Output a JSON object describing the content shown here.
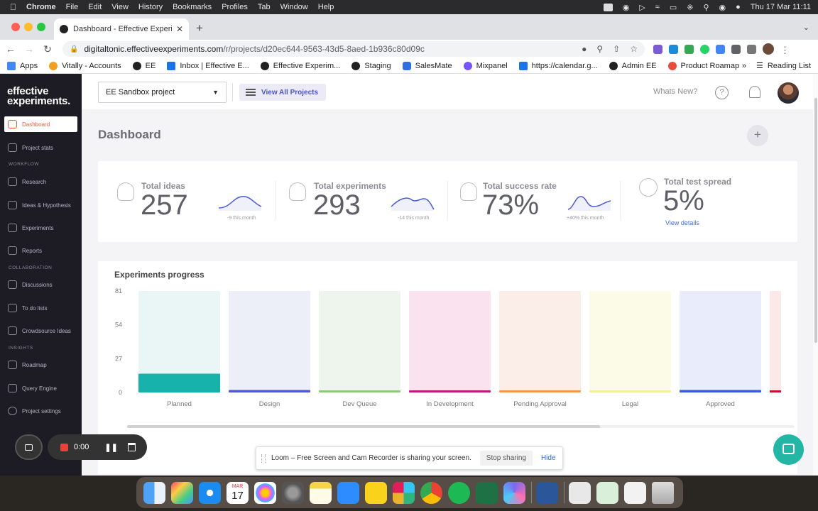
{
  "menubar": {
    "app": "Chrome",
    "items": [
      "File",
      "Edit",
      "View",
      "History",
      "Bookmarks",
      "Profiles",
      "Tab",
      "Window",
      "Help"
    ],
    "datetime": "Thu 17 Mar  11:11"
  },
  "browser": {
    "tab_title": "Dashboard - Effective Experim",
    "url_host": "digitaltonic.effectiveexperiments.com",
    "url_path": "/r/projects/d20ec644-9563-43d5-8aed-1b936c80d09c",
    "bookmarks": [
      "Apps",
      "Vitally - Accounts",
      "EE",
      "Inbox | Effective E...",
      "Effective Experim...",
      "Staging",
      "SalesMate",
      "Mixpanel",
      "https://calendar.g...",
      "Admin EE",
      "Product Roamap"
    ],
    "reading_list": "Reading List"
  },
  "sidebar": {
    "logo_line1": "effective",
    "logo_line2": "experiments.",
    "items": [
      {
        "label": "Dashboard",
        "active": true
      },
      {
        "label": "Project stats"
      },
      {
        "label": "Research"
      },
      {
        "label": "Ideas & Hypothesis"
      },
      {
        "label": "Experiments"
      },
      {
        "label": "Reports"
      },
      {
        "label": "Discussions"
      },
      {
        "label": "To do lists"
      },
      {
        "label": "Crowdsource Ideas"
      },
      {
        "label": "Roadmap"
      },
      {
        "label": "Query Engine"
      },
      {
        "label": "Project settings"
      }
    ],
    "sections": {
      "workflow": "WORKFLOW",
      "collaboration": "COLLABORATION",
      "insights": "INSIGHTS"
    }
  },
  "topbar": {
    "project_select": "EE Sandbox project",
    "view_all": "View All Projects",
    "whats_new": "Whats New?",
    "help": "?"
  },
  "page": {
    "title": "Dashboard",
    "add": "+"
  },
  "stats": [
    {
      "label": "Total ideas",
      "value": "257",
      "sub": "-9 this month"
    },
    {
      "label": "Total experiments",
      "value": "293",
      "sub": "-14 this month"
    },
    {
      "label": "Total success rate",
      "value": "73%",
      "sub": "+40% this month"
    },
    {
      "label": "Total test spread",
      "value": "5%",
      "link": "View details"
    }
  ],
  "progress_title": "Experiments progress",
  "chart_data": {
    "type": "bar",
    "title": "Experiments progress",
    "categories": [
      "Planned",
      "Design",
      "Dev Queue",
      "In Development",
      "Pending Approval",
      "Legal",
      "Approved"
    ],
    "values": [
      15,
      2,
      1,
      1,
      1,
      0,
      2
    ],
    "yticks": [
      0,
      27,
      54,
      81
    ],
    "ylim": [
      0,
      81
    ],
    "colors": [
      "#17b3ab",
      "#4d5bd1",
      "#8fc97a",
      "#c2197a",
      "#f09a4a",
      "#f2efa0",
      "#3b5bd6"
    ],
    "bg_colors": [
      "#eaf6f6",
      "#eceef8",
      "#eef5ec",
      "#fae3ef",
      "#fbeee9",
      "#fbfbe8",
      "#e8ecfb"
    ],
    "grid": false
  },
  "loom": {
    "timer": "0:00",
    "banner": "Loom – Free Screen and Cam Recorder is sharing your screen.",
    "stop": "Stop sharing",
    "hide": "Hide"
  },
  "dock": {
    "calendar_month": "MAR",
    "calendar_day": "17"
  }
}
